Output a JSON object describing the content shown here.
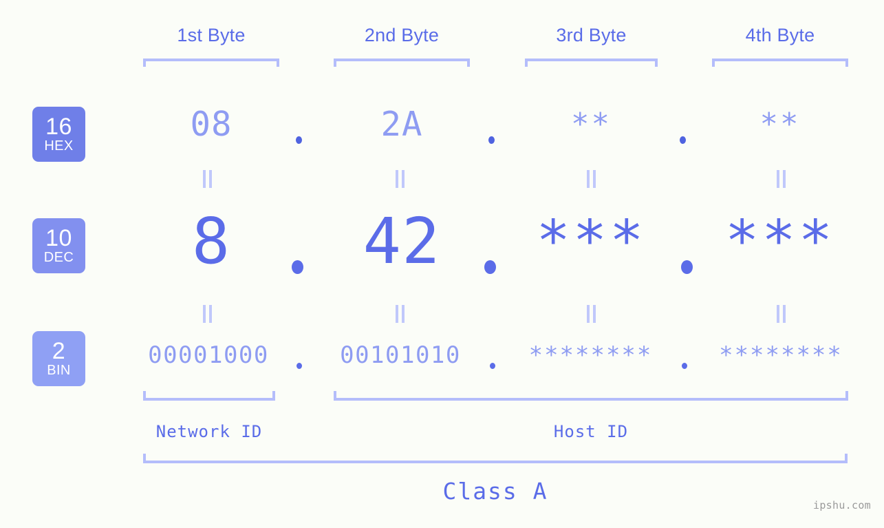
{
  "background_color": "#fbfdf8",
  "accent_color": "#5b6ce8",
  "muted_accent_color": "#8e9cf2",
  "bracket_color": "#b4bdfb",
  "headers": [
    {
      "label": "1st Byte"
    },
    {
      "label": "2nd Byte"
    },
    {
      "label": "3rd Byte"
    },
    {
      "label": "4th Byte"
    }
  ],
  "bases": [
    {
      "number": "16",
      "abbr": "HEX",
      "color": "#6f7fe8"
    },
    {
      "number": "10",
      "abbr": "DEC",
      "color": "#8290ef"
    },
    {
      "number": "2",
      "abbr": "BIN",
      "color": "#8fa0f4"
    }
  ],
  "rows": {
    "hex": {
      "values": [
        "08",
        "2A",
        "**",
        "**"
      ],
      "separator": "."
    },
    "dec": {
      "values": [
        "8",
        "42",
        "***",
        "***"
      ],
      "separator": "."
    },
    "bin": {
      "values": [
        "00001000",
        "00101010",
        "********",
        "********"
      ],
      "separator": "."
    }
  },
  "equals_symbol": "=",
  "segments": {
    "network": {
      "label": "Network ID"
    },
    "host": {
      "label": "Host ID"
    }
  },
  "class": {
    "label": "Class A"
  },
  "watermark": {
    "text": "ipshu.com"
  }
}
